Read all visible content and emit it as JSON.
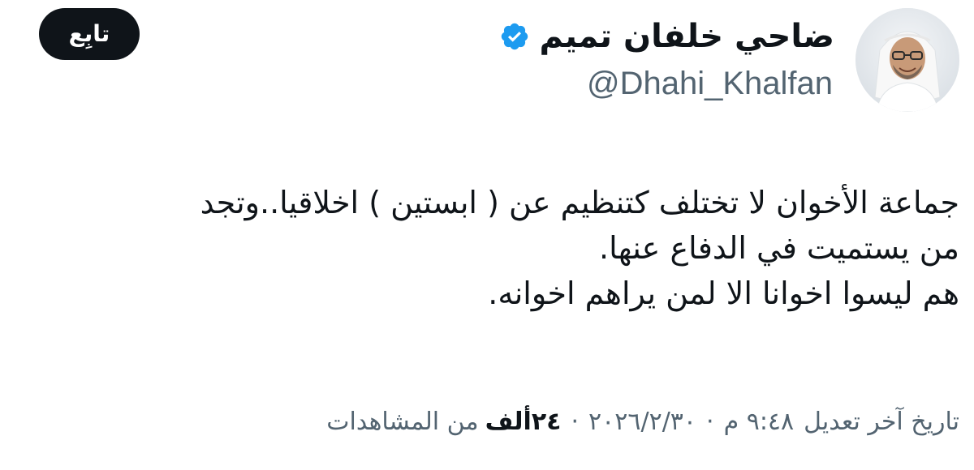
{
  "author": {
    "display_name": "ضاحي خلفان تميم",
    "handle": "@Dhahi_Khalfan",
    "verified": true,
    "avatar_icon": "profile-photo"
  },
  "follow_button": {
    "label": "تابِع"
  },
  "tweet": {
    "lines": [
      "جماعة الأخوان لا تختلف كتنظيم عن ( ابستين ) اخلاقيا..وتجد",
      "من يستميت في الدفاع عنها.",
      "هم ليسوا اخوانا الا لمن يراهم اخوانه."
    ]
  },
  "meta": {
    "edited_label": "تاريخ آخر تعديل",
    "time": "٩:٤٨ م",
    "separator": "·",
    "date": "٢٠٢٦/٢/٣٠",
    "views_count": "٢٤ألف",
    "views_label": "من المشاهدات"
  },
  "colors": {
    "text_primary": "#0f1419",
    "text_secondary": "#536471",
    "verified_blue": "#1d9bf0",
    "button_bg": "#0f1419"
  }
}
